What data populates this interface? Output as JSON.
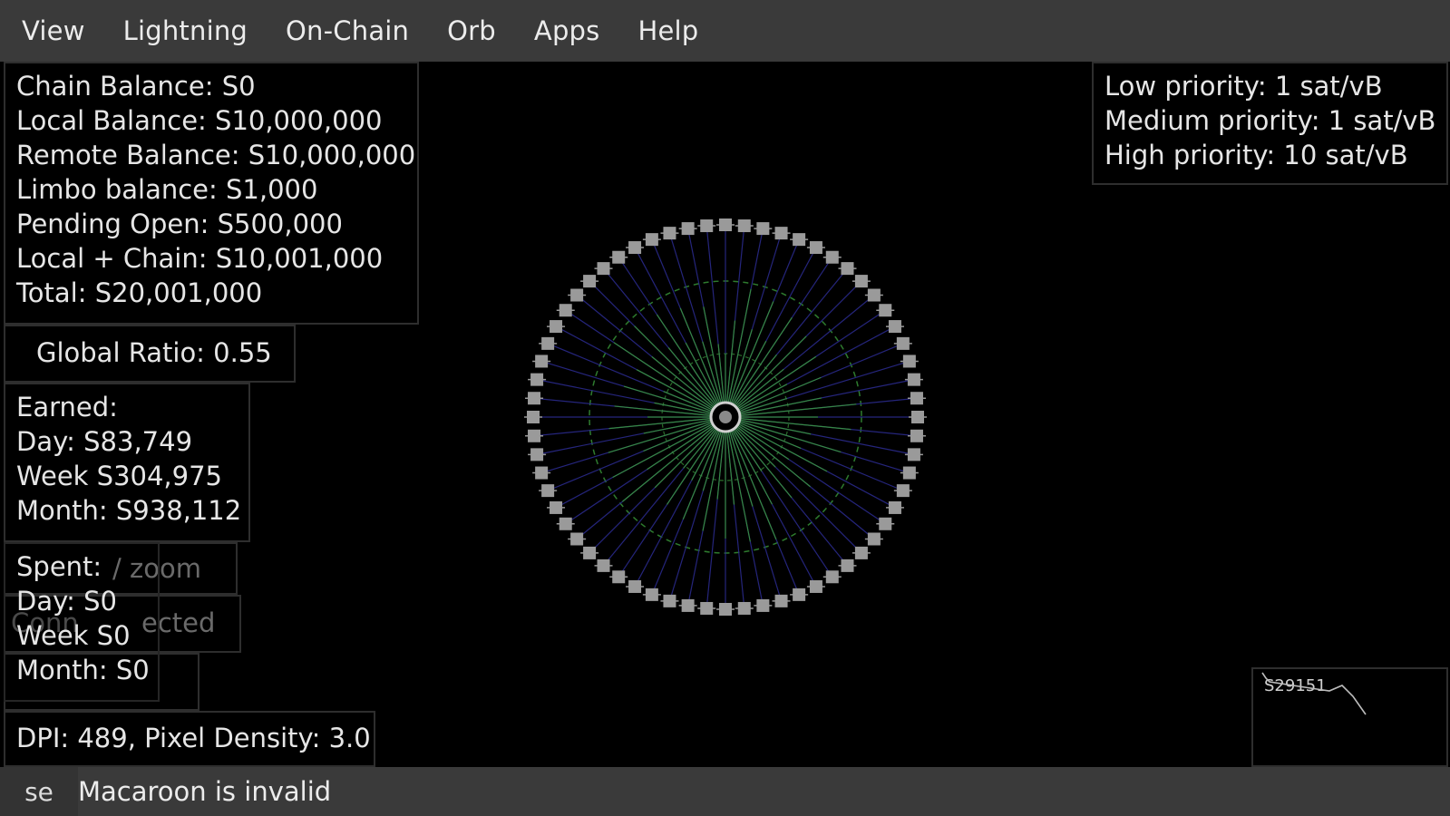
{
  "menu": [
    "View",
    "Lightning",
    "On-Chain",
    "Orb",
    "Apps",
    "Help"
  ],
  "balances": [
    "Chain Balance: S0",
    "Local Balance: S10,000,000",
    "Remote Balance: S10,000,000",
    "Limbo balance: S1,000",
    "Pending Open: S500,000",
    "Local + Chain: S10,001,000",
    "Total: S20,001,000"
  ],
  "global_ratio": "Global Ratio: 0.55",
  "earned": {
    "title": "Earned:",
    "lines": [
      "Day: S83,749",
      "Week S304,975",
      "Month: S938,112"
    ]
  },
  "spent": {
    "title": "Spent:",
    "lines": [
      "Day: S0",
      "Week S0",
      "Month: S0"
    ]
  },
  "ghost": {
    "zoom": "/ zoom",
    "connected": "ected",
    "connected_prefix": "Conn"
  },
  "dpi": "DPI: 489, Pixel Density: 3.0",
  "fees": [
    "Low priority: 1 sat/vB",
    "Medium priority: 1 sat/vB",
    "High priority: 10 sat/vB"
  ],
  "mini_chart": {
    "label": "S29151"
  },
  "statusbar": {
    "button": "se",
    "message": "Macaroon is invalid"
  },
  "orb": {
    "channel_count": 64,
    "colors": {
      "node": "#9a9a9a",
      "remote": "#2a2a8a",
      "local": "#3a9a3a"
    }
  }
}
